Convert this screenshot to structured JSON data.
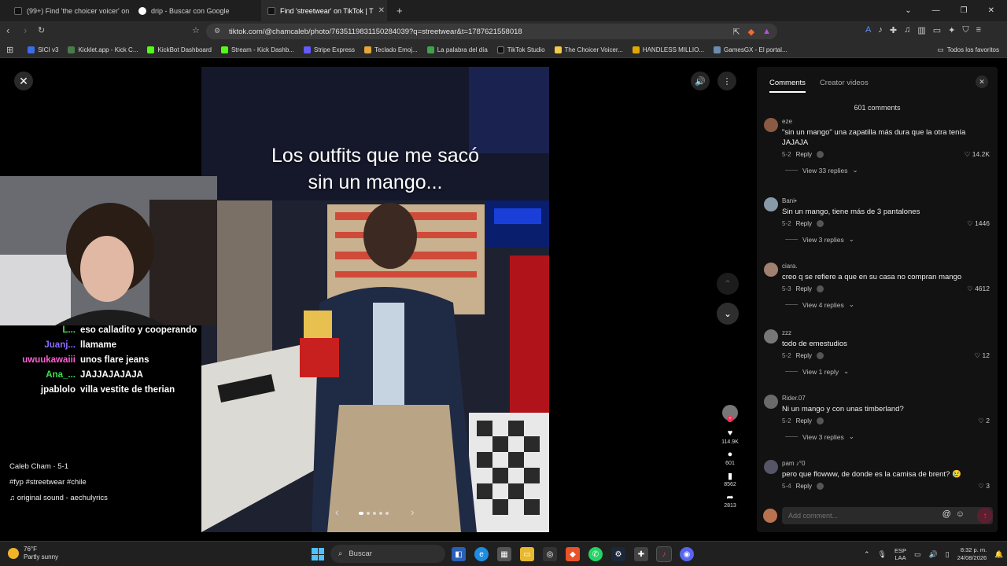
{
  "browser": {
    "tabs": [
      {
        "title": "(99+) Find 'the choicer voicer' on TikTok",
        "active": false
      },
      {
        "title": "drip - Buscar con Google",
        "active": false
      },
      {
        "title": "Find 'streetwear' on TikTok | T",
        "active": true
      }
    ],
    "new_tab": "+",
    "url": "tiktok.com/@chamcaleb/photo/7635119831150284039?q=streetwear&t=1787621558018",
    "bookmarks": [
      "SICI v3",
      "Kicklet.app - Kick C...",
      "KickBot Dashboard",
      "Stream - Kick Dashb...",
      "Stripe Express",
      "Teclado Emoj...",
      "La palabra del día",
      "TikTok Studio",
      "The Choicer Voicer...",
      "HANDLESS MILLIO...",
      "GamesGX - El portal..."
    ],
    "all_bookmarks": "Todos los favoritos"
  },
  "post": {
    "overlay_text_1": "Los outfits que me sacó",
    "overlay_text_2": "sin un mango...",
    "creator_name": "Caleb Cham · 5-1",
    "hashtags": "#fyp #streetwear #chile",
    "sound": "original sound - aechulyrics",
    "likes": "114.9K",
    "comments": "601",
    "saves": "8562",
    "shares": "2813"
  },
  "stream_chat": [
    {
      "user": "L...",
      "user_color": "#3ee04a",
      "message": "eso calladito y cooperando"
    },
    {
      "user": "Juanj...",
      "user_color": "#8a6cff",
      "message": "llamame"
    },
    {
      "user": "uwuukawaiii",
      "user_color": "#ff5fd2",
      "message": "unos flare jeans"
    },
    {
      "user": "Ana_...",
      "user_color": "#3ee04a",
      "message": "JAJJAJAJAJA"
    },
    {
      "user": "jpablolo",
      "user_color": "#ffffff",
      "message": "villa vestite de therian"
    }
  ],
  "comments_panel": {
    "tab_comments": "Comments",
    "tab_creator_videos": "Creator videos",
    "count": "601 comments",
    "input_placeholder": "Add comment...",
    "reply_label": "Reply",
    "comments": [
      {
        "user": "eze",
        "text": "\"sin un mango\" una zapatilla más dura que la otra tenía JAJAJA",
        "date": "5-2",
        "likes": "14.2K",
        "replies": "View 33 replies",
        "avatar": "#8a5a44"
      },
      {
        "user": "Bani•",
        "text": "Sin un mango, tiene más de 3 pantalones",
        "date": "5-2",
        "likes": "1446",
        "replies": "View 3 replies",
        "avatar": "#8899aa"
      },
      {
        "user": "ciara.",
        "text": "creo q se refiere a que en su casa no compran mango",
        "date": "5-3",
        "likes": "4612",
        "replies": "View 4 replies",
        "avatar": "#a08070"
      },
      {
        "user": "zzz",
        "text": "todo de emestudios",
        "date": "5-2",
        "likes": "12",
        "replies": "View 1 reply",
        "avatar": "#777777"
      },
      {
        "user": "Rider.07",
        "text": "Ni un mango y con unas timberland?",
        "date": "5-2",
        "likes": "2",
        "replies": "View 3 replies",
        "avatar": "#6a6a6a"
      },
      {
        "user": "pam ♪°0",
        "text": "pero que flowww, de donde es la camisa de brent? 😢",
        "date": "5-4",
        "likes": "3",
        "replies": "",
        "avatar": "#555566"
      }
    ]
  },
  "taskbar": {
    "temp": "76°F",
    "weather": "Partly sunny",
    "search_placeholder": "Buscar",
    "lang_1": "ESP",
    "lang_2": "LAA",
    "time": "8:32 p. m.",
    "date": "24/08/2026"
  },
  "colors": {
    "tiktok_red": "#fe2c55",
    "panel_bg": "#121212"
  }
}
